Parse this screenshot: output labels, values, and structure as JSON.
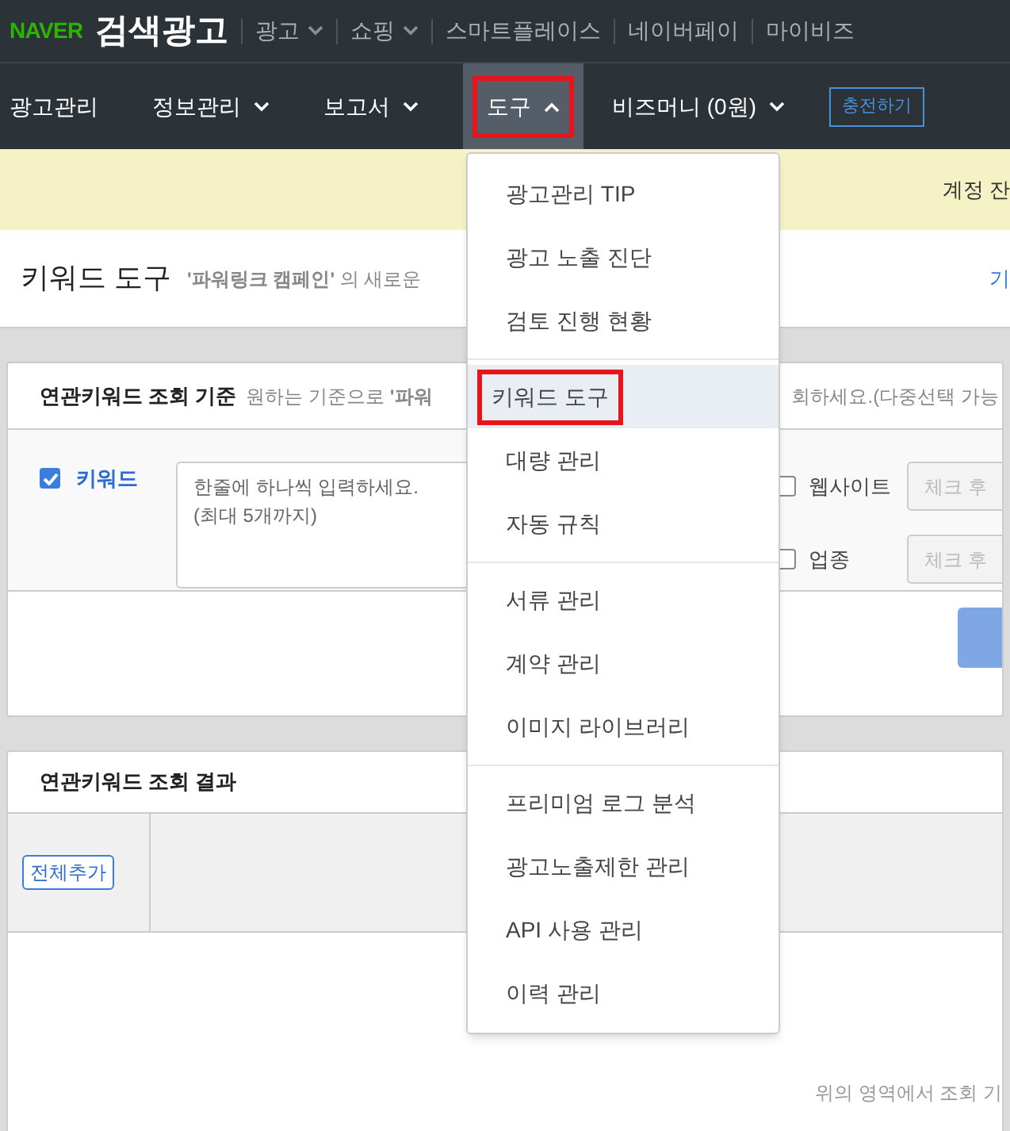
{
  "top_bar": {
    "brand": "NAVER",
    "product": "검색광고",
    "links": [
      {
        "label": "광고",
        "dropdown": true
      },
      {
        "label": "쇼핑",
        "dropdown": true
      },
      {
        "label": "스마트플레이스",
        "dropdown": false
      },
      {
        "label": "네이버페이",
        "dropdown": false
      },
      {
        "label": "마이비즈",
        "dropdown": false
      }
    ]
  },
  "nav": {
    "tabs": [
      {
        "label": "광고관리",
        "selected": false,
        "dropdown": false
      },
      {
        "label": "정보관리",
        "selected": false,
        "dropdown": true
      },
      {
        "label": "보고서",
        "selected": false,
        "dropdown": true
      },
      {
        "label": "도구",
        "selected": true,
        "dropdown": true
      },
      {
        "label": "비즈머니 (0원)",
        "selected": false,
        "dropdown": true
      }
    ],
    "charge_button": "충전하기"
  },
  "banner": {
    "text": "계정 잔"
  },
  "page_header": {
    "title": "키워드 도구",
    "note": "**'파워링크 캠페인'** 의 새로운",
    "link_tail": "기"
  },
  "criteria_card": {
    "title": "연관키워드 조회 기준",
    "hint": "원하는 기준으로 **'파워**",
    "hint_tail": "회하세요.(다중선택 가능",
    "keyword": {
      "label": "키워드",
      "checked": true,
      "placeholder": "한줄에 하나씩 입력하세요.\n(최대 5개까지)"
    },
    "options": [
      {
        "label": "웹사이트",
        "checked": false,
        "placeholder": "체크 후"
      },
      {
        "label": "업종",
        "checked": false,
        "placeholder": "체크 후"
      }
    ]
  },
  "results_card": {
    "title": "연관키워드 조회 결과",
    "add_all_button": "전체추가",
    "empty_text": "위의 영역에서 조회 기"
  },
  "dropdown_menu": {
    "groups": [
      [
        {
          "label": "광고관리 TIP",
          "selected": false
        },
        {
          "label": "광고 노출 진단",
          "selected": false
        },
        {
          "label": "검토 진행 현황",
          "selected": false
        }
      ],
      [
        {
          "label": "키워드 도구",
          "selected": true
        },
        {
          "label": "대량 관리",
          "selected": false
        },
        {
          "label": "자동 규칙",
          "selected": false
        }
      ],
      [
        {
          "label": "서류 관리",
          "selected": false
        },
        {
          "label": "계약 관리",
          "selected": false
        },
        {
          "label": "이미지 라이브러리",
          "selected": false
        }
      ],
      [
        {
          "label": "프리미엄 로그 분석",
          "selected": false
        },
        {
          "label": "광고노출제한 관리",
          "selected": false
        },
        {
          "label": "API 사용 관리",
          "selected": false
        },
        {
          "label": "이력 관리",
          "selected": false
        }
      ]
    ]
  }
}
